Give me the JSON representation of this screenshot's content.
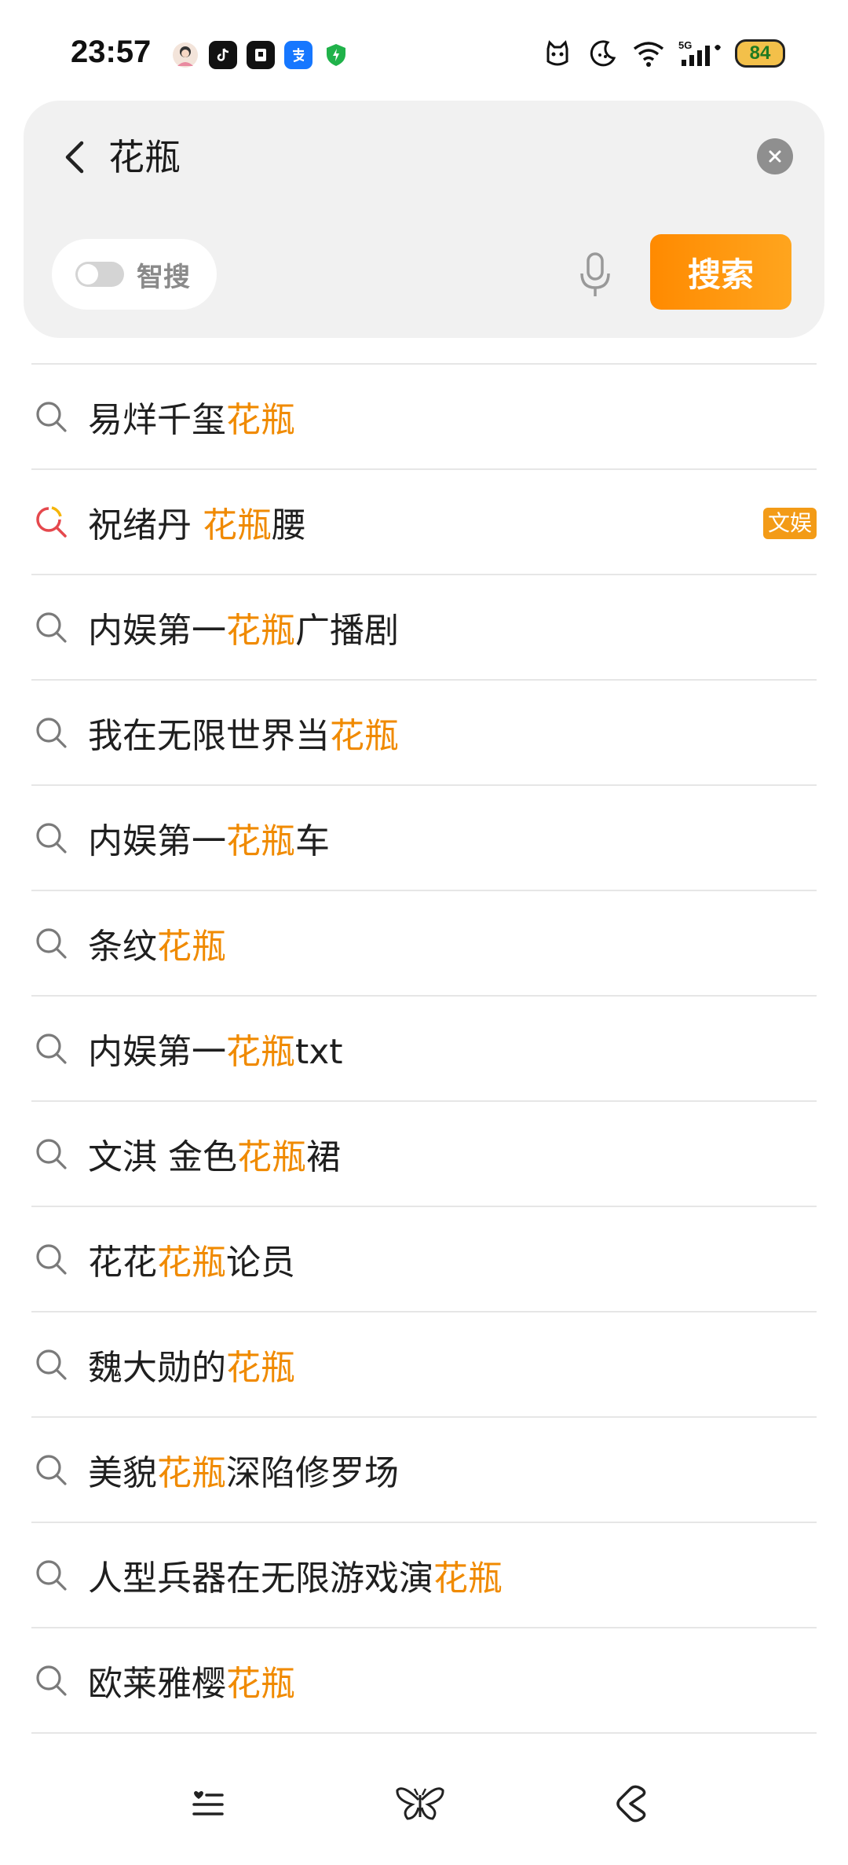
{
  "status_bar": {
    "time": "23:57",
    "app_icons": [
      "avatar-icon",
      "tiktok-icon",
      "notes-icon",
      "alipay-icon",
      "security-shield-icon"
    ],
    "system_icons": [
      "cat-icon",
      "moon-icon",
      "wifi-icon",
      "5g-signal-icon"
    ],
    "network_label": "5G",
    "battery": "84"
  },
  "search": {
    "query": "花瓶",
    "ai_toggle_label": "智搜",
    "ai_toggle_on": false,
    "submit_label": "搜索"
  },
  "suggestions": [
    {
      "parts": [
        {
          "t": "易烊千玺",
          "h": false
        },
        {
          "t": "花瓶",
          "h": true
        }
      ],
      "icon": "search",
      "tag": ""
    },
    {
      "parts": [
        {
          "t": "祝绪丹 ",
          "h": false
        },
        {
          "t": "花瓶",
          "h": true
        },
        {
          "t": "腰",
          "h": false
        }
      ],
      "icon": "hot-search",
      "tag": "文娱"
    },
    {
      "parts": [
        {
          "t": "内娱第一",
          "h": false
        },
        {
          "t": "花瓶",
          "h": true
        },
        {
          "t": "广播剧",
          "h": false
        }
      ],
      "icon": "search",
      "tag": ""
    },
    {
      "parts": [
        {
          "t": "我在无限世界当",
          "h": false
        },
        {
          "t": "花瓶",
          "h": true
        }
      ],
      "icon": "search",
      "tag": ""
    },
    {
      "parts": [
        {
          "t": "内娱第一",
          "h": false
        },
        {
          "t": "花瓶",
          "h": true
        },
        {
          "t": "车",
          "h": false
        }
      ],
      "icon": "search",
      "tag": ""
    },
    {
      "parts": [
        {
          "t": "条纹",
          "h": false
        },
        {
          "t": "花瓶",
          "h": true
        }
      ],
      "icon": "search",
      "tag": ""
    },
    {
      "parts": [
        {
          "t": "内娱第一",
          "h": false
        },
        {
          "t": "花瓶",
          "h": true
        },
        {
          "t": "txt",
          "h": false
        }
      ],
      "icon": "search",
      "tag": ""
    },
    {
      "parts": [
        {
          "t": "文淇 金色",
          "h": false
        },
        {
          "t": "花瓶",
          "h": true
        },
        {
          "t": "裙",
          "h": false
        }
      ],
      "icon": "search",
      "tag": ""
    },
    {
      "parts": [
        {
          "t": "花花",
          "h": false
        },
        {
          "t": "花瓶",
          "h": true
        },
        {
          "t": "论员",
          "h": false
        }
      ],
      "icon": "search",
      "tag": ""
    },
    {
      "parts": [
        {
          "t": "魏大勋的",
          "h": false
        },
        {
          "t": "花瓶",
          "h": true
        }
      ],
      "icon": "search",
      "tag": ""
    },
    {
      "parts": [
        {
          "t": "美貌",
          "h": false
        },
        {
          "t": "花瓶",
          "h": true
        },
        {
          "t": "深陷修罗场",
          "h": false
        }
      ],
      "icon": "search",
      "tag": ""
    },
    {
      "parts": [
        {
          "t": "人型兵器在无限游戏演",
          "h": false
        },
        {
          "t": "花瓶",
          "h": true
        }
      ],
      "icon": "search",
      "tag": ""
    },
    {
      "parts": [
        {
          "t": "欧莱雅樱",
          "h": false
        },
        {
          "t": "花瓶",
          "h": true
        }
      ],
      "icon": "search",
      "tag": ""
    }
  ],
  "bottom_nav": [
    "list-icon",
    "butterfly-icon",
    "back-gesture-icon"
  ],
  "colors": {
    "accent": "#f08a00",
    "button_start": "#ff8a00",
    "button_end": "#ffa51e",
    "tag_bg": "#f39b17",
    "panel_bg": "#f1f1f1",
    "hot_icon": "#e5484d"
  }
}
